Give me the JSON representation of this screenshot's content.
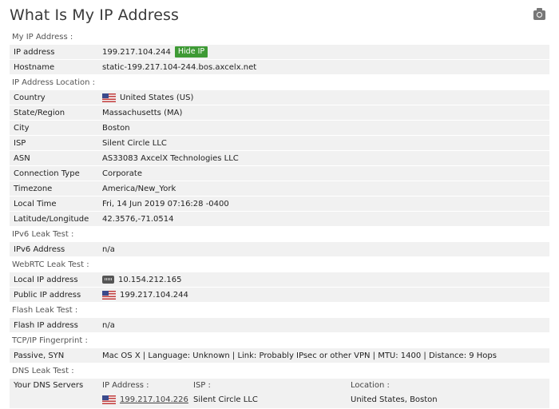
{
  "title": "What Is My IP Address",
  "sections": {
    "my_ip": "My IP Address :",
    "location": "IP Address Location :",
    "ipv6": "IPv6 Leak Test :",
    "webrtc": "WebRTC Leak Test :",
    "flash": "Flash Leak Test :",
    "tcp": "TCP/IP Fingerprint :",
    "dns": "DNS Leak Test :"
  },
  "my_ip": {
    "ip_label": "IP address",
    "ip_value": "199.217.104.244",
    "hide_button": "Hide IP",
    "host_label": "Hostname",
    "host_value": "static-199.217.104-244.bos.axcelx.net"
  },
  "location": {
    "country_label": "Country",
    "country_value": "United States (US)",
    "state_label": "State/Region",
    "state_value": "Massachusetts (MA)",
    "city_label": "City",
    "city_value": "Boston",
    "isp_label": "ISP",
    "isp_value": "Silent Circle LLC",
    "asn_label": "ASN",
    "asn_value": "AS33083 AxcelX Technologies LLC",
    "conn_label": "Connection Type",
    "conn_value": "Corporate",
    "tz_label": "Timezone",
    "tz_value": "America/New_York",
    "time_label": "Local Time",
    "time_value": "Fri, 14 Jun 2019 07:16:28 -0400",
    "latlon_label": "Latitude/Longitude",
    "latlon_value": "42.3576,-71.0514"
  },
  "ipv6": {
    "label": "IPv6 Address",
    "value": "n/a"
  },
  "webrtc": {
    "local_label": "Local IP address",
    "local_value": "10.154.212.165",
    "public_label": "Public IP address",
    "public_value": "199.217.104.244"
  },
  "flash": {
    "label": "Flash IP address",
    "value": "n/a"
  },
  "tcp": {
    "label": "Passive, SYN",
    "value": "Mac OS X | Language: Unknown | Link: Probably IPsec or other VPN | MTU: 1400 | Distance: 9 Hops"
  },
  "dns": {
    "label": "Your DNS Servers",
    "col_ip": "IP Address :",
    "col_isp": "ISP :",
    "col_location": "Location :",
    "server_ip": "199.217.104.226",
    "server_isp": "Silent Circle LLC",
    "server_location": "United States, Boston"
  },
  "colors": {
    "hide_badge": "#3e9a35",
    "row_bg": "#f1f1f1"
  },
  "icons": {
    "camera": "camera-icon",
    "flag": "us-flag-icon",
    "lan": "network-card-icon"
  }
}
